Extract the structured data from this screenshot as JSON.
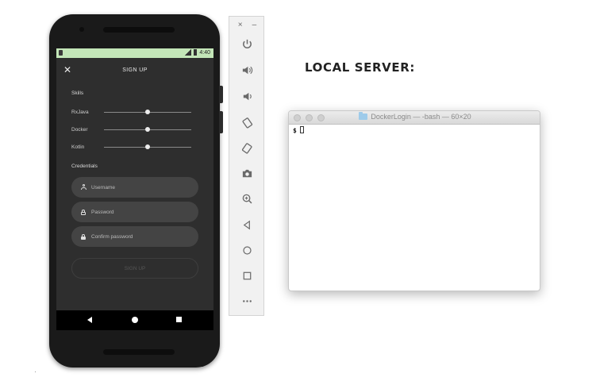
{
  "phone": {
    "status_time": "4:40",
    "app_title": "SIGN UP",
    "skills_label": "Skills",
    "skills": [
      {
        "label": "RxJava",
        "level": 0.5
      },
      {
        "label": "Docker",
        "level": 0.5
      },
      {
        "label": "Kotlin",
        "level": 0.5
      }
    ],
    "credentials_label": "Credentials",
    "fields": {
      "username_placeholder": "Username",
      "password_placeholder": "Password",
      "confirm_placeholder": "Confirm password"
    },
    "signup_button": "SIGN UP"
  },
  "emulator_toolbar": {
    "close": "×",
    "minimize": "–",
    "buttons": [
      "power-icon",
      "volume-up-icon",
      "volume-down-icon",
      "rotate-left-icon",
      "rotate-right-icon",
      "camera-icon",
      "zoom-icon",
      "back-icon",
      "home-icon",
      "overview-icon",
      "more-icon"
    ]
  },
  "right": {
    "heading": "LOCAL SERVER:",
    "terminal_title": "DockerLogin — -bash — 60×20",
    "prompt": "$"
  }
}
